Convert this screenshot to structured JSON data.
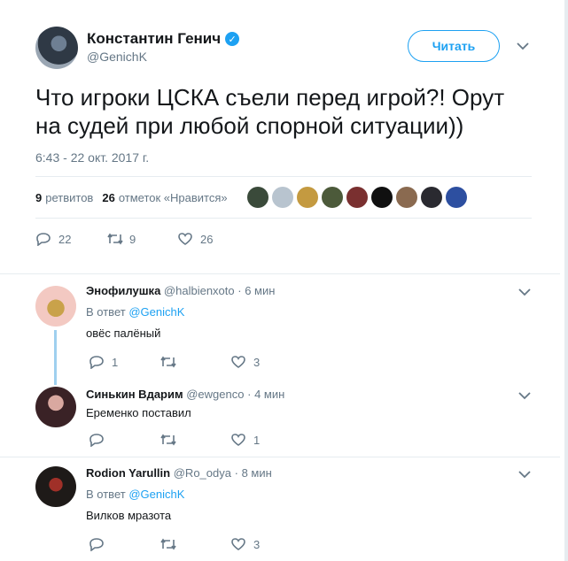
{
  "main": {
    "name": "Константин Генич",
    "handle": "@GenichK",
    "follow_label": "Читать",
    "text": "Что игроки ЦСКА съели перед игрой?! Орут на судей при любой спорной ситуации))",
    "time": "6:43 - 22 окт. 2017 г.",
    "retweets_count": "9",
    "retweets_label": "ретвитов",
    "likes_count": "26",
    "likes_label": "отметок «Нравится»",
    "actions": {
      "replies": "22",
      "retweets": "9",
      "likes": "26"
    },
    "liker_colors": [
      "#3a4a3a",
      "#b8c4cf",
      "#c49a40",
      "#4c5a3a",
      "#7a3030",
      "#101010",
      "#8a6a50",
      "#2a2a30",
      "#2d4fa0"
    ]
  },
  "replies": [
    {
      "name": "Энофилушка",
      "handle": "@halbienxoto",
      "time": "6 мин",
      "in_reply_prefix": "В ответ",
      "in_reply_mention": "@GenichK",
      "text": "овёс палёный",
      "replies": "1",
      "retweets": "",
      "likes": "3"
    },
    {
      "name": "Синькин Вдарим",
      "handle": "@ewgenco",
      "time": "4 мин",
      "text": "Еременко поставил",
      "replies": "",
      "retweets": "",
      "likes": "1"
    },
    {
      "name": "Rodion Yarullin",
      "handle": "@Ro_odya",
      "time": "8 мин",
      "in_reply_prefix": "В ответ",
      "in_reply_mention": "@GenichK",
      "text": "Вилков мразота",
      "replies": "",
      "retweets": "",
      "likes": "3"
    }
  ],
  "colors": {
    "accent": "#1da1f2",
    "muted": "#657786",
    "thread": "#9fd0ef"
  }
}
